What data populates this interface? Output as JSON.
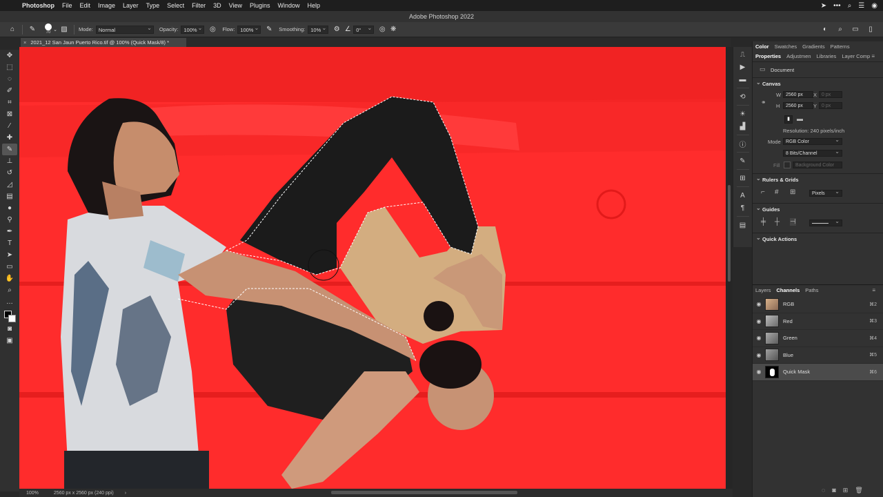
{
  "menubar": {
    "app": "Photoshop",
    "items": [
      "File",
      "Edit",
      "Image",
      "Layer",
      "Type",
      "Select",
      "Filter",
      "3D",
      "View",
      "Plugins",
      "Window",
      "Help"
    ]
  },
  "window": {
    "title": "Adobe Photoshop 2022"
  },
  "options": {
    "brush_size": "70",
    "mode_label": "Mode:",
    "mode_value": "Normal",
    "opacity_label": "Opacity:",
    "opacity_value": "100%",
    "flow_label": "Flow:",
    "flow_value": "100%",
    "smoothing_label": "Smoothing:",
    "smoothing_value": "10%",
    "angle_value": "0°"
  },
  "document": {
    "tab_title": "2021_12 San Jaun Puerto Rico.tif @ 100% (Quick Mask/8) *",
    "close": "×"
  },
  "status": {
    "zoom": "100%",
    "doc_info": "2560 px x 2560 px (240 ppi)",
    "arrow": "›"
  },
  "panel_tabs_top": [
    "Color",
    "Swatches",
    "Gradients",
    "Patterns"
  ],
  "panel_tabs_mid": [
    "Properties",
    "Adjustmen",
    "Libraries",
    "Layer Comp"
  ],
  "properties": {
    "doc_label": "Document",
    "canvas_title": "Canvas",
    "w_label": "W",
    "w_value": "2560 px",
    "x_label": "X",
    "x_value": "0 px",
    "h_label": "H",
    "h_value": "2560 px",
    "y_label": "Y",
    "y_value": "0 px",
    "resolution": "Resolution: 240 pixels/inch",
    "mode_label": "Mode",
    "mode_value": "RGB Color",
    "bits_value": "8 Bits/Channel",
    "fill_label": "Fill",
    "fill_value": "Background Color",
    "rulers_title": "Rulers & Grids",
    "units_value": "Pixels",
    "guides_title": "Guides",
    "quick_actions_title": "Quick Actions"
  },
  "channels_tabs": [
    "Layers",
    "Channels",
    "Paths"
  ],
  "channels": [
    {
      "name": "RGB",
      "shortcut": "⌘2",
      "thumb": "#c79a6a"
    },
    {
      "name": "Red",
      "shortcut": "⌘3",
      "thumb": "#9a9a9a"
    },
    {
      "name": "Green",
      "shortcut": "⌘4",
      "thumb": "#8c8c8c"
    },
    {
      "name": "Blue",
      "shortcut": "⌘5",
      "thumb": "#858585"
    },
    {
      "name": "Quick Mask",
      "shortcut": "⌘6",
      "thumb": "#000000"
    }
  ],
  "colors": {
    "mask_red": "#ff2c2c",
    "ui_dark": "#323232"
  }
}
